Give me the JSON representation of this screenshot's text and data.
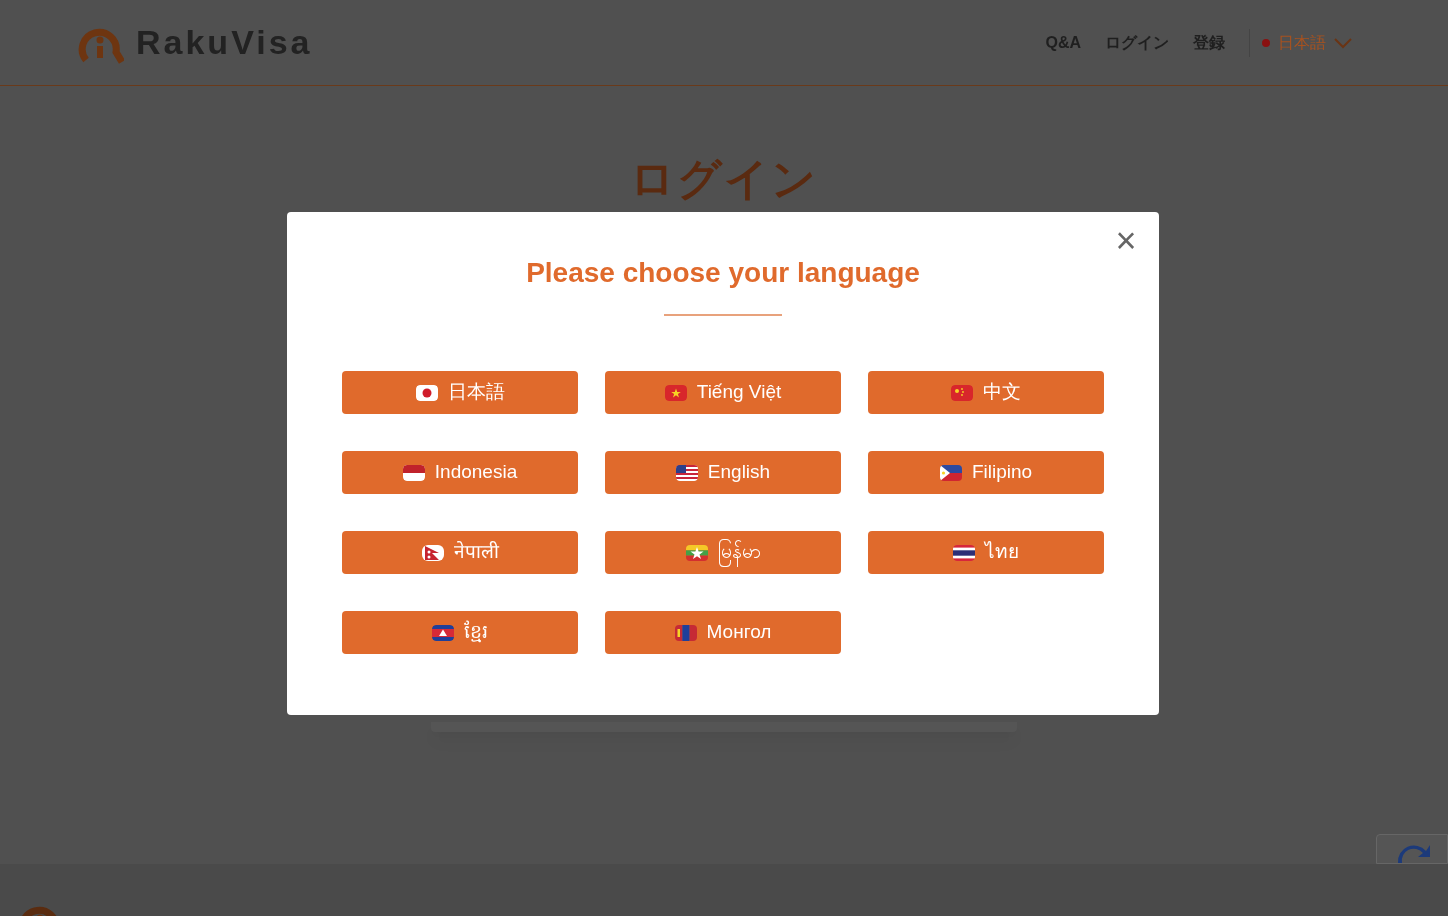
{
  "header": {
    "logo_text": "RakuVisa",
    "nav": [
      {
        "label": "Q&A"
      },
      {
        "label": "ログイン"
      },
      {
        "label": "登録"
      }
    ],
    "language": {
      "label": "日本語",
      "color": "#8a1010"
    }
  },
  "page": {
    "title": "ログイン"
  },
  "modal": {
    "title": "Please choose your language",
    "close": "×",
    "languages": [
      {
        "label": "日本語"
      },
      {
        "label": "Tiếng Việt"
      },
      {
        "label": "中文"
      },
      {
        "label": "Indonesia"
      },
      {
        "label": "English"
      },
      {
        "label": "Filipino"
      },
      {
        "label": "नेपाली"
      },
      {
        "label": "မြန်မာ"
      },
      {
        "label": "ไทย"
      },
      {
        "label": "ខ្មែរ"
      },
      {
        "label": "Монгол"
      }
    ]
  }
}
